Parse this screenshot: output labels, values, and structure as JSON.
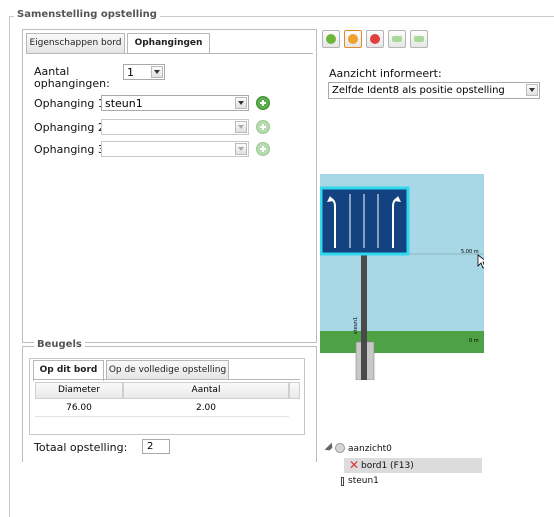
{
  "fieldset": {
    "legend": "Samenstelling opstelling"
  },
  "tabs": [
    {
      "label": "Eigenschappen bord",
      "active": false
    },
    {
      "label": "Ophangingen",
      "active": true
    }
  ],
  "ophangingen": {
    "aantal_label_line1": "Aantal",
    "aantal_label_line2": "ophangingen:",
    "aantal_value": "1",
    "rows": [
      {
        "label": "Ophanging 1:",
        "value": "steun1",
        "enabled": true
      },
      {
        "label": "Ophanging 2:",
        "value": "",
        "enabled": false
      },
      {
        "label": "Ophanging 3:",
        "value": "",
        "enabled": false
      }
    ]
  },
  "beugels": {
    "legend": "Beugels",
    "tabs": [
      {
        "label": "Op dit bord",
        "active": true
      },
      {
        "label": "Op de volledige opstelling",
        "active": false
      }
    ],
    "columns": [
      "Diameter",
      "Aantal"
    ],
    "rows": [
      [
        "76.00",
        "2.00"
      ]
    ],
    "totaal_label": "Totaal opstelling:",
    "totaal_value": "2"
  },
  "toolbar": {
    "buttons": [
      {
        "name": "refresh-icon",
        "color": "#6fb53c"
      },
      {
        "name": "highlight-icon",
        "color": "#f0a030"
      },
      {
        "name": "delete-icon",
        "color": "#e04040"
      },
      {
        "name": "arrow-left-icon",
        "color": "#a8d89a"
      },
      {
        "name": "arrow-right-icon",
        "color": "#a8d89a"
      }
    ]
  },
  "aanzicht": {
    "label": "Aanzicht informeert:",
    "value": "Zelfde Ident8 als positie opstelling"
  },
  "preview": {
    "sky_color": "#a8d8e6",
    "grass_color": "#4ea145",
    "sign_color": "#12427f",
    "sign_border": "#2fd7ef",
    "dim_label_top": "5.00 m",
    "dim_label_ground": "0 m",
    "pole_label": "steun1"
  },
  "tree": {
    "root": "aanzicht0",
    "child": "bord1 (F13)",
    "grandchild": "steun1"
  }
}
